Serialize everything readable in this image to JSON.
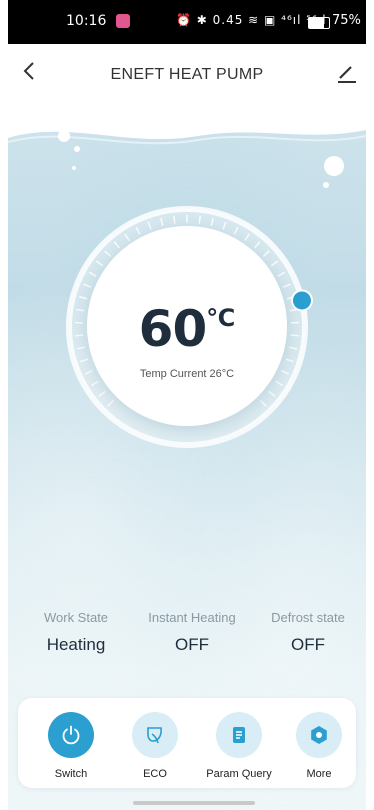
{
  "status_bar": {
    "time": "10:16",
    "icons_text": "⏰ ✱ 0.45 ≋ ▣ ⁴⁶ıl ⁵⁶ıl",
    "battery_pct": "75%",
    "battery_level": 0.75
  },
  "header": {
    "title": "ENEFT HEAT PUMP",
    "back_icon": "chevron-left-icon",
    "edit_icon": "pencil-icon"
  },
  "thermostat": {
    "set_temp": "60",
    "unit": "℃",
    "current_label": "Temp Current 26°C",
    "accent": "#2a9fd0"
  },
  "states": [
    {
      "label": "Work State",
      "value": "Heating"
    },
    {
      "label": "Instant Heating",
      "value": "OFF"
    },
    {
      "label": "Defrost state",
      "value": "OFF"
    }
  ],
  "actions": [
    {
      "label": "Switch",
      "icon": "power-icon"
    },
    {
      "label": "ECO",
      "icon": "leaf-icon"
    },
    {
      "label": "Param Query",
      "icon": "document-icon"
    },
    {
      "label": "More",
      "icon": "gear-icon"
    }
  ],
  "colors": {
    "primary": "#2a9fd0",
    "icon_bg": "#d8edf6",
    "text_dark": "#1f2d3d"
  }
}
